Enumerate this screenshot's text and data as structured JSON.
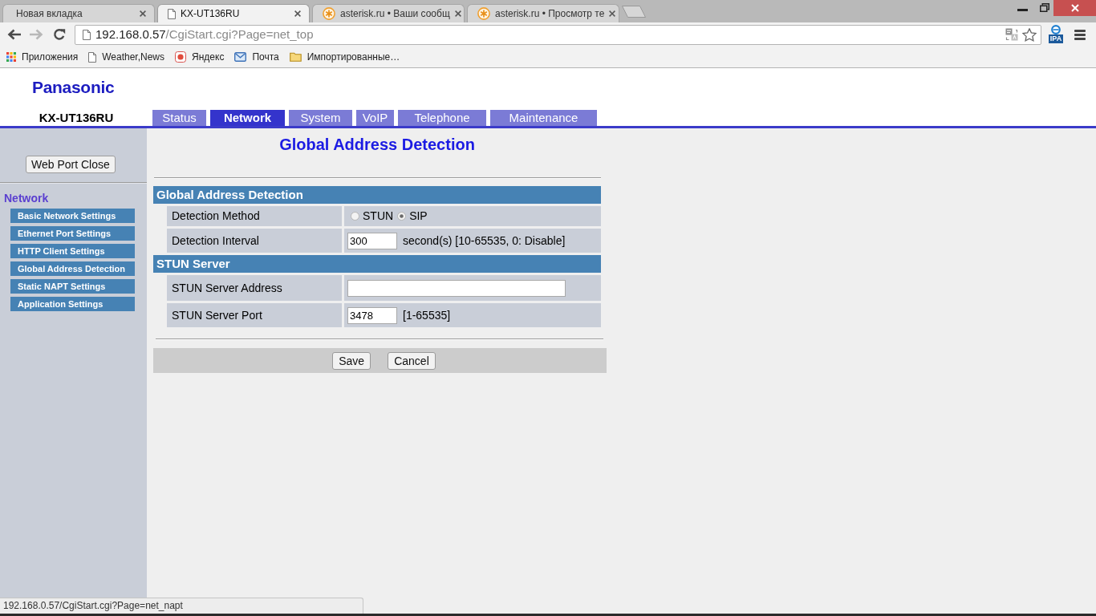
{
  "browser": {
    "tabs": [
      {
        "title": "Новая вкладка",
        "kind": "blank",
        "selected": false
      },
      {
        "title": "KX-UT136RU",
        "kind": "page",
        "selected": true
      },
      {
        "title": "asterisk.ru • Ваши сообщ",
        "kind": "asterisk",
        "selected": false
      },
      {
        "title": "asterisk.ru • Просмотр те",
        "kind": "asterisk",
        "selected": false
      }
    ],
    "address_bar": {
      "host": "192.168.0.57",
      "path": "/CgiStart.cgi?Page=net_top"
    },
    "extension": {
      "label": "IPA"
    },
    "bookmarks": [
      {
        "label": "Приложения",
        "kind": "apps"
      },
      {
        "label": "Weather,News",
        "kind": "page"
      },
      {
        "label": "Яндекс",
        "kind": "site"
      },
      {
        "label": "Почта",
        "kind": "mail"
      },
      {
        "label": "Импортированные…",
        "kind": "folder"
      }
    ],
    "status_url": "192.168.0.57/CgiStart.cgi?Page=net_napt"
  },
  "header": {
    "brand": "Panasonic",
    "model": "KX-UT136RU",
    "tabs": [
      {
        "label": "Status",
        "selected": false
      },
      {
        "label": "Network",
        "selected": true
      },
      {
        "label": "System",
        "selected": false
      },
      {
        "label": "VoIP",
        "selected": false
      },
      {
        "label": "Telephone",
        "selected": false
      },
      {
        "label": "Maintenance",
        "selected": false
      }
    ]
  },
  "sidebar": {
    "button": "Web Port Close",
    "section": "Network",
    "items": [
      {
        "label": "Basic Network Settings"
      },
      {
        "label": "Ethernet Port Settings"
      },
      {
        "label": "HTTP Client Settings"
      },
      {
        "label": "Global Address Detection"
      },
      {
        "label": "Static NAPT Settings"
      },
      {
        "label": "Application Settings"
      }
    ]
  },
  "form": {
    "title": "Global Address Detection",
    "sections": [
      {
        "heading": "Global Address Detection",
        "rows": [
          {
            "kind": "radio",
            "label": "Detection Method",
            "options": [
              {
                "label": "STUN",
                "selected": false
              },
              {
                "label": "SIP",
                "selected": true
              }
            ]
          },
          {
            "kind": "number",
            "label": "Detection Interval",
            "value": "300",
            "hint": "second(s) [10-65535, 0: Disable]"
          }
        ]
      },
      {
        "heading": "STUN Server",
        "rows": [
          {
            "kind": "text",
            "label": "STUN Server Address"
          },
          {
            "kind": "number",
            "label": "STUN Server Port",
            "value": "3478",
            "hint": "[1-65535]"
          }
        ]
      }
    ],
    "buttons": [
      "Save",
      "Cancel"
    ]
  }
}
